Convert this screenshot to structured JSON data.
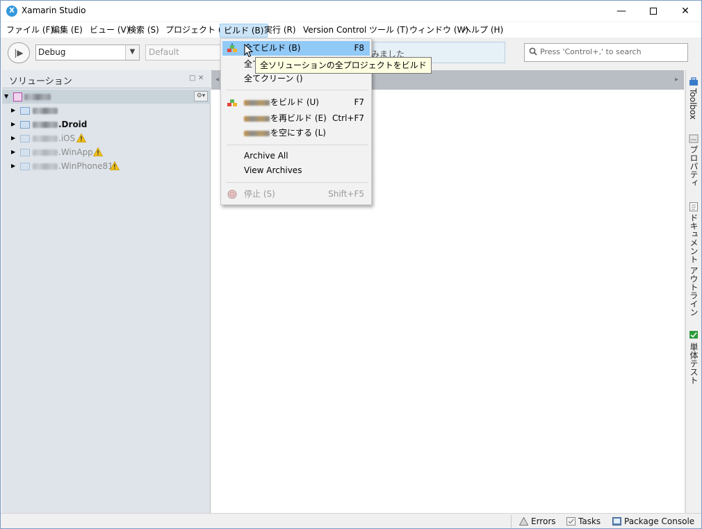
{
  "window": {
    "title": "Xamarin Studio",
    "minimize": "—",
    "close": "✕"
  },
  "menubar": [
    {
      "label": "ファイル (F)"
    },
    {
      "label": "編集 (E)"
    },
    {
      "label": "ビュー (V)"
    },
    {
      "label": "検索 (S)"
    },
    {
      "label": "プロジェクト (P)"
    },
    {
      "label": "ビルド (B)"
    },
    {
      "label": "実行 (R)"
    },
    {
      "label": "Version Control"
    },
    {
      "label": "ツール (T)"
    },
    {
      "label": "ウィンドウ (W)"
    },
    {
      "label": "ヘルプ (H)"
    }
  ],
  "toolbar": {
    "run_icon": "|▶",
    "configuration": "Debug",
    "target": "Default",
    "status_fragment": "みました",
    "search_placeholder": "Press 'Control+,' to search"
  },
  "solution_pad": {
    "title": "ソリューション",
    "controls": [
      "□",
      "✕"
    ],
    "gear_label": "⚙▾",
    "tree": [
      {
        "suffix": "",
        "kind": "solution",
        "warning": false,
        "selected": true
      },
      {
        "suffix": "",
        "kind": "project",
        "warning": false
      },
      {
        "suffix": ".Droid",
        "kind": "project",
        "warning": false
      },
      {
        "suffix": ".iOS",
        "kind": "project",
        "warning": true
      },
      {
        "suffix": ".WinApp",
        "kind": "project",
        "warning": true
      },
      {
        "suffix": ".WinPhone81",
        "kind": "project",
        "warning": true
      }
    ]
  },
  "build_menu": {
    "items": [
      {
        "label": "全てビルド (B)",
        "shortcut": "F8",
        "highlighted": true
      },
      {
        "label": "全て",
        "shortcut": ""
      },
      {
        "label": "全てクリーン ()",
        "shortcut": ""
      },
      {
        "label": "をビルド (U)",
        "shortcut": "F7"
      },
      {
        "label": "を再ビルド (E)",
        "shortcut": "Ctrl+F7"
      },
      {
        "label": "を空にする (L)",
        "shortcut": ""
      },
      {
        "label": "Archive All",
        "shortcut": ""
      },
      {
        "label": "View Archives",
        "shortcut": ""
      },
      {
        "label": "停止 (S)",
        "shortcut": "Shift+F5",
        "disabled": true
      }
    ],
    "tooltip": "全ソリューションの全プロジェクトをビルド"
  },
  "side_pads": [
    {
      "label": "Toolbox"
    },
    {
      "label": "プロパティ"
    },
    {
      "label": "ドキュメント アウトライン"
    },
    {
      "label": "単体テスト"
    }
  ],
  "statusbar": {
    "errors": "Errors",
    "tasks": "Tasks",
    "package_console": "Package Console"
  },
  "colors": {
    "menu_highlight": "#91c9f7",
    "tooltip_bg": "#ffffe1",
    "warning": "#f2c018",
    "accent": "#3498db"
  }
}
